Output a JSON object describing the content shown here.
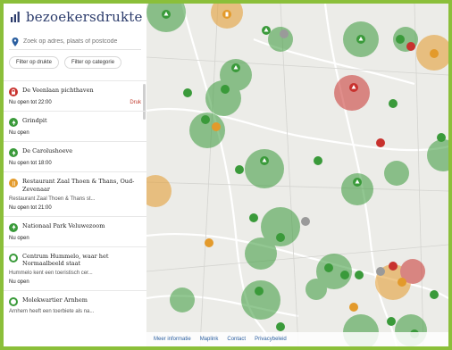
{
  "brand": {
    "title": "bezoekersdrukte"
  },
  "search": {
    "placeholder": "Zoek op adres, plaats of postcode"
  },
  "filters": {
    "drukte": "Filter op drukte",
    "categorie": "Filter op categorie"
  },
  "list": [
    {
      "name": "De Veenlaan pichthaven",
      "status": "Nu open tot 22:00",
      "alert": "Druk",
      "color": "#c8322e"
    },
    {
      "name": "Grindpit",
      "status": "Nu open",
      "color": "#3a9a3a"
    },
    {
      "name": "De Carolushoeve",
      "status": "Nu open tot 18:00",
      "color": "#3a9a3a"
    },
    {
      "name": "Restaurant Zaal Thoen & Thans, Oud-Zevenaar",
      "sub": "Restaurant Zaal Thoen & Thans st...",
      "status": "Nu open tot 21:00",
      "color": "#e39a2b"
    },
    {
      "name": "Nationaal Park Veluwezoom",
      "status": "Nu open",
      "color": "#3a9a3a"
    },
    {
      "name": "Centrum Hummelo, waar het Normaalbeeld staat",
      "sub": "Hummelo kent een toeristisch cer...",
      "status": "Nu open",
      "color": "#3a9a3a"
    },
    {
      "name": "Molekwartier Arnhem",
      "sub": "Arnhem heeft een toerbiete als na...",
      "color": "#3a9a3a"
    }
  ],
  "map": {
    "footer": [
      "Meer informatie",
      "Maplink",
      "Contact",
      "Privacybeleid"
    ]
  },
  "colors": {
    "green": "#3a9a3a",
    "orange": "#e39a2b",
    "red": "#c8322e",
    "accent": "#8bbf3a",
    "brand": "#2b3b6b"
  }
}
